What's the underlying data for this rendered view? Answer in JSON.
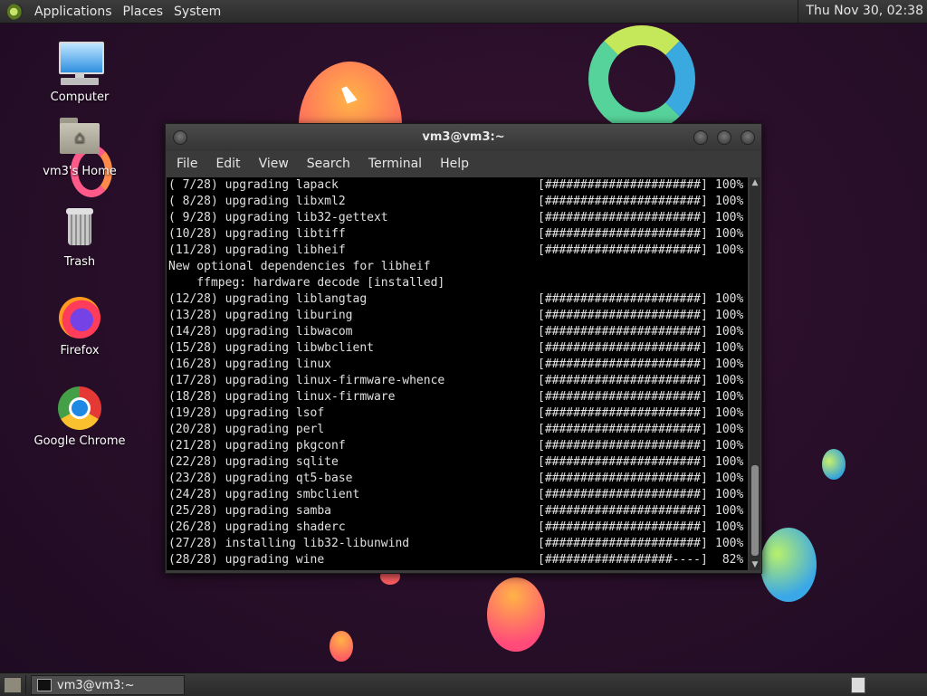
{
  "top_panel": {
    "menus": [
      "Applications",
      "Places",
      "System"
    ],
    "clock": "Thu Nov 30, 02:38"
  },
  "desktop_icons": [
    {
      "label": "Computer",
      "icon": "computer-icon"
    },
    {
      "label": "vm3's Home",
      "icon": "home-folder-icon"
    },
    {
      "label": "Trash",
      "icon": "trash-icon"
    },
    {
      "label": "Firefox",
      "icon": "firefox-icon"
    },
    {
      "label": "Google Chrome",
      "icon": "chrome-icon"
    }
  ],
  "terminal": {
    "title": "vm3@vm3:~",
    "menu": [
      "File",
      "Edit",
      "View",
      "Search",
      "Terminal",
      "Help"
    ],
    "lines": [
      {
        "text": "( 7/28) upgrading lapack",
        "bar": "[######################]",
        "pct": "100%"
      },
      {
        "text": "( 8/28) upgrading libxml2",
        "bar": "[######################]",
        "pct": "100%"
      },
      {
        "text": "( 9/28) upgrading lib32-gettext",
        "bar": "[######################]",
        "pct": "100%"
      },
      {
        "text": "(10/28) upgrading libtiff",
        "bar": "[######################]",
        "pct": "100%"
      },
      {
        "text": "(11/28) upgrading libheif",
        "bar": "[######################]",
        "pct": "100%"
      },
      {
        "text": "New optional dependencies for libheif",
        "bar": "",
        "pct": ""
      },
      {
        "text": "    ffmpeg: hardware decode [installed]",
        "bar": "",
        "pct": ""
      },
      {
        "text": "(12/28) upgrading liblangtag",
        "bar": "[######################]",
        "pct": "100%"
      },
      {
        "text": "(13/28) upgrading liburing",
        "bar": "[######################]",
        "pct": "100%"
      },
      {
        "text": "(14/28) upgrading libwacom",
        "bar": "[######################]",
        "pct": "100%"
      },
      {
        "text": "(15/28) upgrading libwbclient",
        "bar": "[######################]",
        "pct": "100%"
      },
      {
        "text": "(16/28) upgrading linux",
        "bar": "[######################]",
        "pct": "100%"
      },
      {
        "text": "(17/28) upgrading linux-firmware-whence",
        "bar": "[######################]",
        "pct": "100%"
      },
      {
        "text": "(18/28) upgrading linux-firmware",
        "bar": "[######################]",
        "pct": "100%"
      },
      {
        "text": "(19/28) upgrading lsof",
        "bar": "[######################]",
        "pct": "100%"
      },
      {
        "text": "(20/28) upgrading perl",
        "bar": "[######################]",
        "pct": "100%"
      },
      {
        "text": "(21/28) upgrading pkgconf",
        "bar": "[######################]",
        "pct": "100%"
      },
      {
        "text": "(22/28) upgrading sqlite",
        "bar": "[######################]",
        "pct": "100%"
      },
      {
        "text": "(23/28) upgrading qt5-base",
        "bar": "[######################]",
        "pct": "100%"
      },
      {
        "text": "(24/28) upgrading smbclient",
        "bar": "[######################]",
        "pct": "100%"
      },
      {
        "text": "(25/28) upgrading samba",
        "bar": "[######################]",
        "pct": "100%"
      },
      {
        "text": "(26/28) upgrading shaderc",
        "bar": "[######################]",
        "pct": "100%"
      },
      {
        "text": "(27/28) installing lib32-libunwind",
        "bar": "[######################]",
        "pct": "100%"
      },
      {
        "text": "(28/28) upgrading wine",
        "bar": "[##################----]",
        "pct": " 82%"
      }
    ]
  },
  "taskbar": {
    "task_label": "vm3@vm3:~"
  }
}
